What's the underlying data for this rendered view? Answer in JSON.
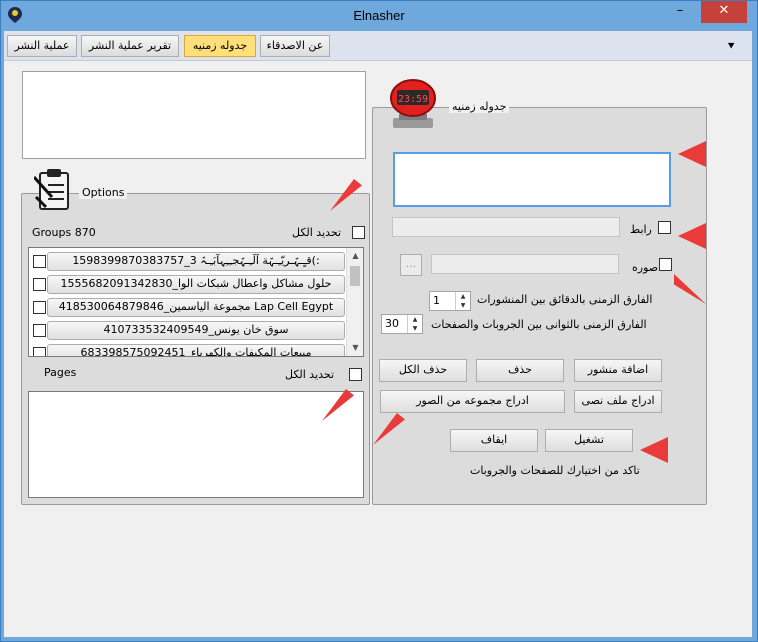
{
  "window": {
    "title": "Elnasher",
    "minimize": "–",
    "close": "✕"
  },
  "toolbar": {
    "buttons": [
      {
        "label": "عملية النشر"
      },
      {
        "label": "تقرير عملية النشر"
      },
      {
        "label": "جدوله زمنيه"
      },
      {
        "label": "عن الاصدقاء"
      }
    ],
    "menu_glyph": "⯆"
  },
  "options": {
    "title": "Options",
    "groups_label": "Groups 870",
    "select_all": "تحديد الكل",
    "groups": [
      ":)قـٍـہّـريّـِـہّة آلَـِـہّجـِـِہآبَـِـہّ 3_1598399870383757",
      "حلول مشاكل واعطال شبكات الوا_1555682091342830",
      "Lap Cell Egypt مجموعة الياسمين_418530064879846",
      "سوق خان يونس_410733532409549",
      "مبيعات المكيفات والكهرباء_683398575092451"
    ],
    "pages_label": "Pages",
    "pages_select_all": "تحديد الكل"
  },
  "schedule": {
    "title": "جدوله زمنيه",
    "clock_text": "23:59",
    "link_label": "رابط",
    "image_label": "صوره",
    "browse": "...",
    "interval_posts_label": "الفارق الزمنى بالدقائق بين المنشورات",
    "interval_posts_value": "1",
    "interval_groups_label": "الفارق الزمنى بالثوانى بين الجروبات والصفحات",
    "interval_groups_value": "30",
    "buttons": {
      "add_post": "اضافة منشور",
      "delete": "حذف",
      "delete_all": "حذف الكل",
      "insert_text_file": "ادراج ملف نصى",
      "insert_images": "ادراج مجموعه من الصور",
      "start": "تشغيل",
      "stop": "ايقاف"
    },
    "hint": "تاكد من اختيارك للصفحات والجروبات"
  },
  "colors": {
    "title_bar": "#6fa8dc",
    "active_tab": "#ffdf7a",
    "annotation_arrow": "#ea3a3a"
  }
}
